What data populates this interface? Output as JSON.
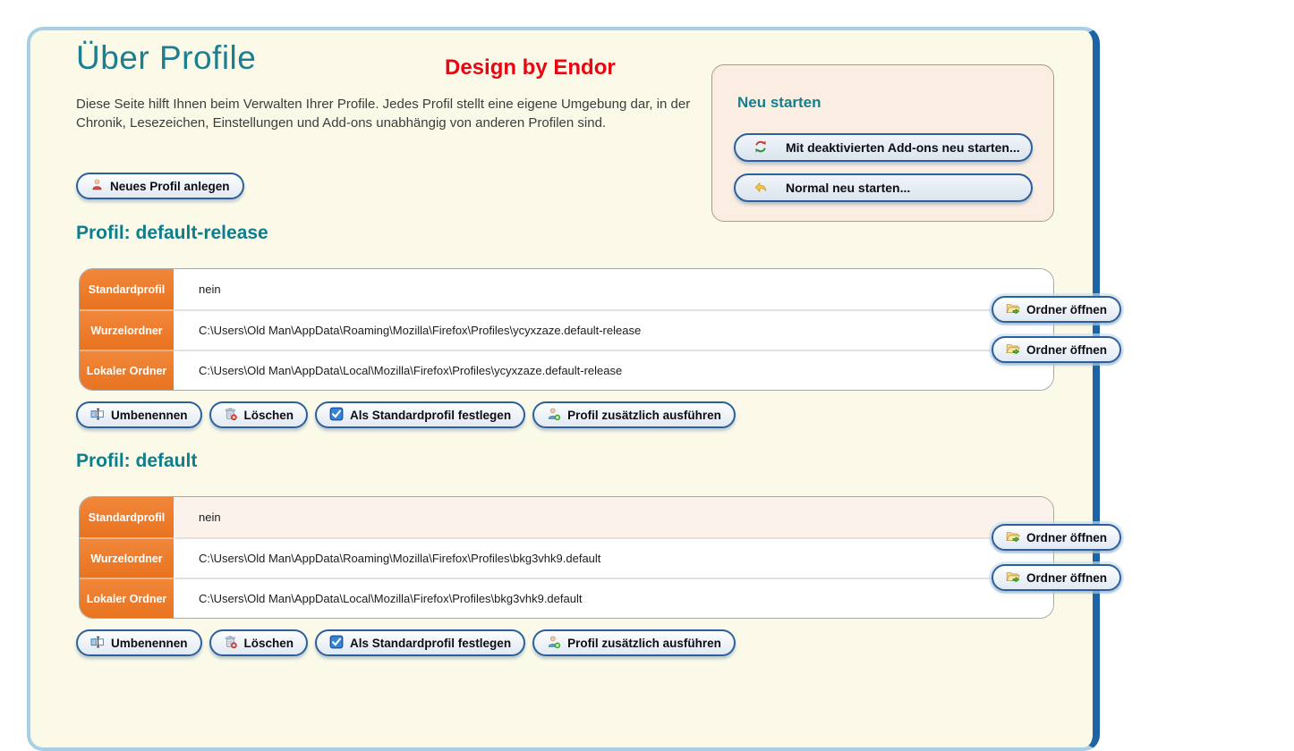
{
  "page": {
    "title": "Über Profile",
    "watermark": "Design by Endor",
    "description": "Diese Seite hilft Ihnen beim Verwalten Ihrer Profile. Jedes Profil stellt eine eigene Umgebung dar, in der Chronik, Lesezeichen, Einstellungen und Add-ons unabhängig von anderen Profilen sind.",
    "create_button_label": "Neues Profil anlegen"
  },
  "restart_box": {
    "title": "Neu starten",
    "buttons": [
      {
        "label": "Mit deaktivierten Add-ons neu starten...",
        "icon": "refresh-icon"
      },
      {
        "label": "Normal neu starten...",
        "icon": "undo-icon"
      }
    ]
  },
  "profiles": [
    {
      "heading": "Profil: default-release",
      "rows": [
        {
          "label": "Standardprofil",
          "value": "nein"
        },
        {
          "label": "Wurzelordner",
          "value": "C:\\Users\\Old Man\\AppData\\Roaming\\Mozilla\\Firefox\\Profiles\\ycyxzaze.default-release",
          "open_button": "Ordner öffnen"
        },
        {
          "label": "Lokaler Ordner",
          "value": "C:\\Users\\Old Man\\AppData\\Local\\Mozilla\\Firefox\\Profiles\\ycyxzaze.default-release",
          "open_button": "Ordner öffnen"
        }
      ],
      "actions": [
        "Umbenennen",
        "Löschen",
        "Als Standardprofil festlegen",
        "Profil zusätzlich ausführen"
      ]
    },
    {
      "heading": "Profil: default",
      "rows": [
        {
          "label": "Standardprofil",
          "value": "nein"
        },
        {
          "label": "Wurzelordner",
          "value": "C:\\Users\\Old Man\\AppData\\Roaming\\Mozilla\\Firefox\\Profiles\\bkg3vhk9.default",
          "open_button": "Ordner öffnen"
        },
        {
          "label": "Lokaler Ordner",
          "value": "C:\\Users\\Old Man\\AppData\\Local\\Mozilla\\Firefox\\Profiles\\bkg3vhk9.default",
          "open_button": "Ordner öffnen"
        }
      ],
      "actions": [
        "Umbenennen",
        "Löschen",
        "Als Standardprofil festlegen",
        "Profil zusätzlich ausführen"
      ]
    }
  ],
  "icons": [
    "new-profile-person-icon",
    "refresh-icon",
    "undo-icon",
    "folder-open-icon",
    "rename-icon",
    "trash-delete-icon",
    "checkbox-checked-icon",
    "person-add-icon"
  ],
  "colors": {
    "accent_teal": "#0e7d8c",
    "watermark_red": "#e80612",
    "row_label_orange": "#ee7b2b",
    "button_border_blue": "#2c609c",
    "panel_border_light": "#a9cfe5",
    "panel_border_dark": "#1e64a4",
    "panel_background": "#fbfae8",
    "restart_box_background": "#faeee2"
  }
}
